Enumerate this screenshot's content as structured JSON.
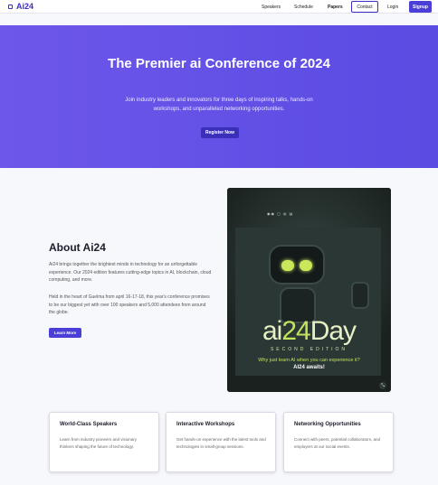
{
  "nav": {
    "logo": "Ai24",
    "links": [
      "Speakers",
      "Schedule",
      "Papers"
    ],
    "contact": "Contact",
    "login": "Login",
    "signup": "Signup"
  },
  "hero": {
    "title": "The Premier ai Conference of 2024",
    "subtitle": "Join industry leaders and innovators for three days of inspiring talks, hands-on workshops, and unparalleled networking opportunities.",
    "cta": "Register Now"
  },
  "about": {
    "title": "About Ai24",
    "paragraph1": "Ai24 brings together the brightest minds in technology for an unforgettable experience. Our 2024 edition features cutting-edge topics in AI, blockchain, cloud computing, and more.",
    "paragraph2": "Held in the heart of Guelma from april 16-17-18, this year's conference promises to be our biggest yet with over 100 speakers and 5,000 attendees from around the globe.",
    "button": "Learn More"
  },
  "poster": {
    "brand_prefix": "ai",
    "brand_number": "24",
    "brand_suffix": "Day",
    "edition": "SECOND EDITION",
    "line1": "Why just learn AI when you can experience it?",
    "line2": "AI24 awaits!",
    "expand": "⤡"
  },
  "features": [
    {
      "title": "World-Class Speakers",
      "body": "Learn from industry pioneers and visionary thinkers shaping the future of technology."
    },
    {
      "title": "Interactive Workshops",
      "body": "Get hands-on experience with the latest tools and technologies in small-group sessions."
    },
    {
      "title": "Networking Opportunities",
      "body": "Connect with peers, potential collaborators, and employers at our social events."
    }
  ],
  "colors": {
    "accent": "#4b3fd8",
    "hero_start": "#6d57ea",
    "hero_end": "#5a4be2"
  }
}
